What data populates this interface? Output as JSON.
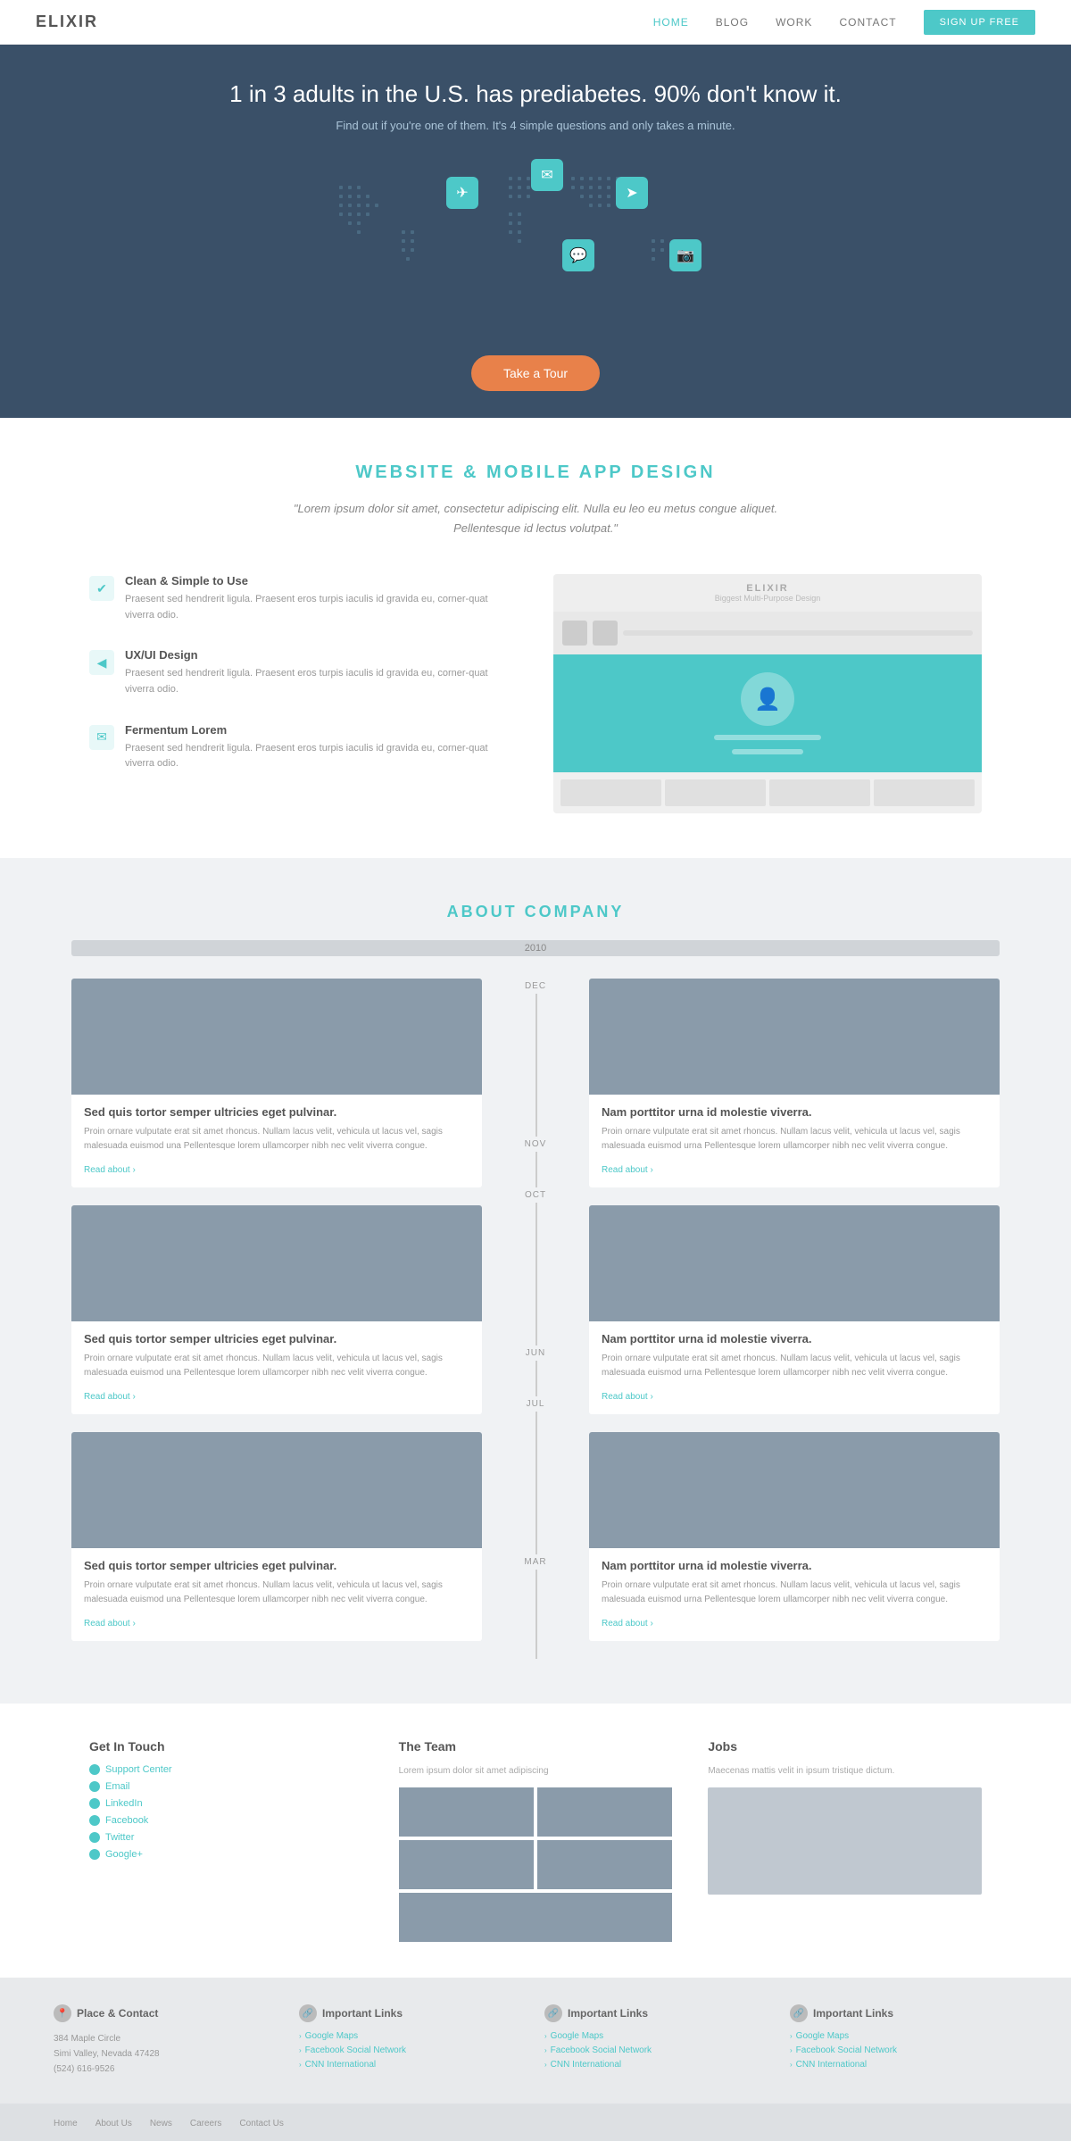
{
  "navbar": {
    "logo": "ELIXIR",
    "links": [
      {
        "label": "HOME",
        "active": true
      },
      {
        "label": "BLOG",
        "active": false
      },
      {
        "label": "WORK",
        "active": false
      },
      {
        "label": "CONTACT",
        "active": false
      }
    ],
    "cta": "SIgn Up Free"
  },
  "hero": {
    "headline": "1 in 3 adults in the U.S. has prediabetes. 90% don't know it.",
    "subtext": "Find out if you're one of them. It's 4 simple questions and only takes a minute.",
    "cta": "Take a Tour"
  },
  "website_section": {
    "title": "WEBSITE & MOBILE APP DESIGN",
    "quote": "\"Lorem ipsum dolor sit amet, consectetur adipiscing elit. Nulla eu leo eu metus congue aliquet. Pellentesque id lectus volutpat.\"",
    "features": [
      {
        "icon": "✔",
        "title": "Clean & Simple to Use",
        "desc": "Praesent sed hendrerit ligula. Praesent eros turpis iaculis id gravida eu, corner-quat viverra odio."
      },
      {
        "icon": "◀",
        "title": "UX/UI Design",
        "desc": "Praesent sed hendrerit ligula. Praesent eros turpis iaculis id gravida eu, corner-quat viverra odio."
      },
      {
        "icon": "✉",
        "title": "Fermentum Lorem",
        "desc": "Praesent sed hendrerit ligula. Praesent eros turpis iaculis id gravida eu, corner-quat viverra odio."
      }
    ],
    "mockup": {
      "logo": "ELIXIR",
      "tagline": "Biggest Multi-Purpose Design"
    }
  },
  "about_section": {
    "title": "ABOUT COMPANY",
    "year": "2010",
    "months_left": [
      "DEC",
      "OCT",
      "JUL"
    ],
    "months_right": [
      "NOV",
      "JUN",
      "MAR"
    ],
    "left_posts": [
      {
        "title": "Sed quis tortor semper ultricies eget pulvinar.",
        "desc": "Proin ornare vulputate erat sit amet rhoncus. Nullam lacus velit, vehicula ut lacus vel, sagis malesuada euismod una Pellentesque lorem ullamcorper nibh nec velit viverra congue."
      },
      {
        "title": "Sed quis tortor semper ultricies eget pulvinar.",
        "desc": "Proin ornare vulputate erat sit amet rhoncus. Nullam lacus velit, vehicula ut lacus vel, sagis malesuada euismod una Pellentesque lorem ullamcorper nibh nec velit viverra congue."
      },
      {
        "title": "Sed quis tortor semper ultricies eget pulvinar.",
        "desc": "Proin ornare vulputate erat sit amet rhoncus. Nullam lacus velit, vehicula ut lacus vel, sagis malesuada euismod una Pellentesque lorem ullamcorper nibh nec velit viverra congue."
      }
    ],
    "right_posts": [
      {
        "title": "Nam porttitor urna id molestie viverra.",
        "desc": "Proin ornare vulputate erat sit amet rhoncus. Nullam lacus velit, vehicula ut lacus vel, sagis malesuada euismod urna Pellentesque lorem ullamcorper nibh nec velit viverra congue."
      },
      {
        "title": "Nam porttitor urna id molestie viverra.",
        "desc": "Proin ornare vulputate erat sit amet rhoncus. Nullam lacus velit, vehicula ut lacus vel, sagis malesuada euismod urna Pellentesque lorem ullamcorper nibh nec velit viverra congue."
      },
      {
        "title": "Nam porttitor urna id molestie viverra.",
        "desc": "Proin ornare vulputate erat sit amet rhoncus. Nullam lacus velit, vehicula ut lacus vel, sagis malesuada euismod urna Pellentesque lorem ullamcorper nibh nec velit viverra congue."
      }
    ],
    "read_more": "Read about ›"
  },
  "footer_top": {
    "get_in_touch": {
      "title": "Get In Touch",
      "links": [
        "Support Center",
        "Email",
        "LinkedIn",
        "Facebook",
        "Twitter",
        "Google+"
      ]
    },
    "the_team": {
      "title": "The Team",
      "desc": "Lorem ipsum dolor sit amet adipiscing"
    },
    "jobs": {
      "title": "Jobs",
      "desc": "Maecenas mattis velit in ipsum tristique dictum."
    }
  },
  "footer_bottom": {
    "cols": [
      {
        "icon": "📍",
        "title": "Place & Contact",
        "lines": [
          "384 Maple Circle",
          "Simi Valley, Nevada 47428",
          "(524) 616-9526"
        ]
      },
      {
        "icon": "🔗",
        "title": "Important Links",
        "links": [
          "Google Maps",
          "Facebook Social Network",
          "CNN International"
        ]
      },
      {
        "icon": "🔗",
        "title": "Important Links",
        "links": [
          "Google Maps",
          "Facebook Social Network",
          "CNN International"
        ]
      },
      {
        "icon": "🔗",
        "title": "Important Links",
        "links": [
          "Google Maps",
          "Facebook Social Network",
          "CNN International"
        ]
      }
    ]
  },
  "footer_bar": {
    "links": [
      "Home",
      "About Us",
      "News",
      "Careers",
      "Contact Us"
    ]
  }
}
